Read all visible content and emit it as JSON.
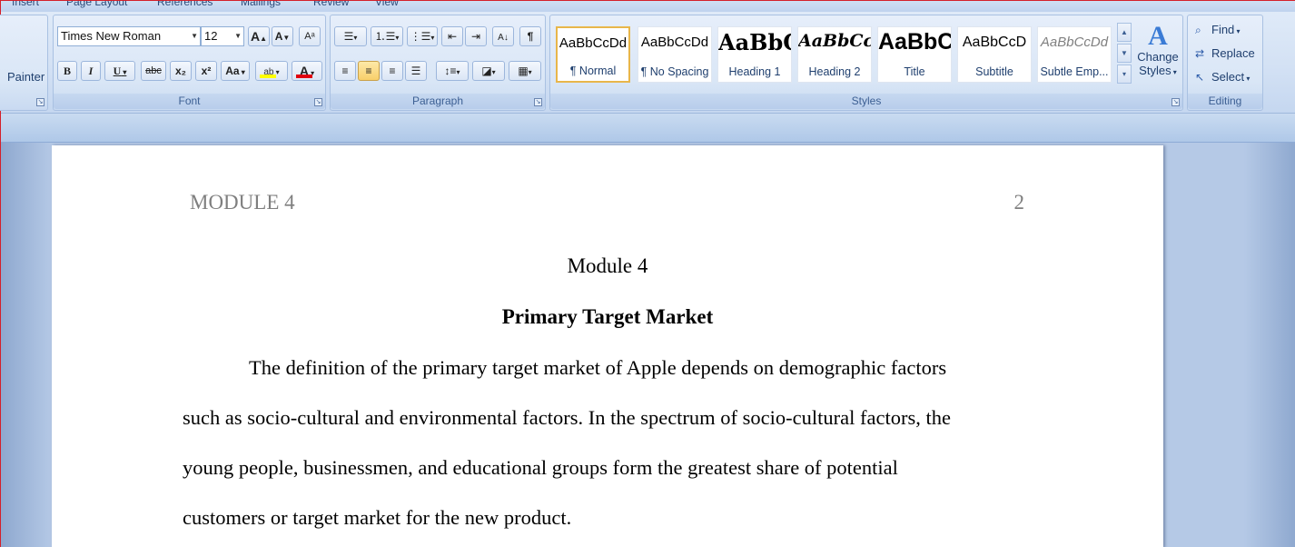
{
  "tabs": [
    "Insert",
    "Page Layout",
    "References",
    "Mailings",
    "Review",
    "View"
  ],
  "clipboard": {
    "painter_label": "Painter"
  },
  "font_group": {
    "label": "Font",
    "font_name": "Times New Roman",
    "font_size": "12",
    "grow_icon": "A",
    "shrink_icon": "A",
    "clear_icon": "Aᵃ",
    "bold": "B",
    "italic": "I",
    "underline": "U",
    "strike": "abc",
    "subscript": "x₂",
    "superscript": "x²",
    "change_case": "Aa",
    "highlight": "ab",
    "font_color": "A",
    "highlight_color": "#ffff00",
    "font_color_bar": "#e0000f"
  },
  "paragraph_group": {
    "label": "Paragraph",
    "show_marks": "¶"
  },
  "styles_group": {
    "label": "Styles",
    "tiles": [
      {
        "sample": "AaBbCcDd",
        "name": "¶ Normal"
      },
      {
        "sample": "AaBbCcDd",
        "name": "¶ No Spacing"
      },
      {
        "sample": "AaBbC",
        "name": "Heading 1"
      },
      {
        "sample": "AaBbCc",
        "name": "Heading 2"
      },
      {
        "sample": "AaBbC",
        "name": "Title"
      },
      {
        "sample": "AaBbCcD",
        "name": "Subtitle"
      },
      {
        "sample": "AaBbCcDd",
        "name": "Subtle Emp..."
      }
    ],
    "change_styles_line1": "Change",
    "change_styles_line2": "Styles"
  },
  "editing_group": {
    "label": "Editing",
    "find": "Find",
    "replace": "Replace",
    "select": "Select"
  },
  "document": {
    "header_left": "MODULE 4",
    "header_right": "2",
    "title": "Module 4",
    "heading": "Primary Target Market",
    "lines": [
      "The definition of the primary target market of Apple depends on demographic factors",
      "such as socio-cultural and environmental factors. In the spectrum of socio-cultural factors, the",
      "young people, businessmen, and educational groups form the greatest share of potential",
      "customers or target market for the new product."
    ]
  }
}
